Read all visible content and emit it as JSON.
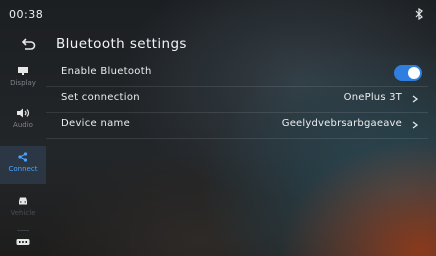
{
  "status": {
    "time": "00:38",
    "bluetooth_icon": "bluetooth-icon"
  },
  "header": {
    "title": "Bluetooth settings",
    "back_icon": "back-arrow-icon"
  },
  "sidebar": {
    "items": [
      {
        "label": "Display",
        "icon": "display-icon",
        "active": false
      },
      {
        "label": "Audio",
        "icon": "speaker-icon",
        "active": false
      },
      {
        "label": "Connect",
        "icon": "share-icon",
        "active": true
      },
      {
        "label": "Vehicle",
        "icon": "car-icon",
        "active": false
      },
      {
        "label": "",
        "icon": "settings-more-icon",
        "active": false
      }
    ]
  },
  "settings": {
    "enable_bluetooth": {
      "label": "Enable Bluetooth",
      "enabled": true
    },
    "set_connection": {
      "label": "Set connection",
      "value": "OnePlus 3T"
    },
    "device_name": {
      "label": "Device name",
      "value": "Geelydvebrsarbgaeave"
    }
  },
  "colors": {
    "accent": "#2f7fe0",
    "active_nav": "#4aa3ff"
  }
}
